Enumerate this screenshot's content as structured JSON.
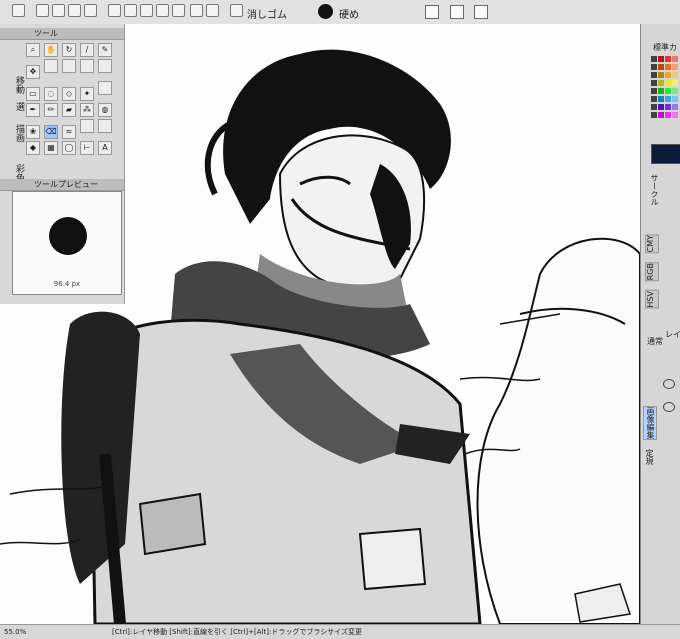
{
  "toolbar": {
    "eraser_label": "消しゴム",
    "hardness_label": "硬め",
    "icons": [
      "gear-icon",
      "new-file-icon",
      "open-file-icon",
      "save-icon",
      "print-icon",
      "undo-icon",
      "redo-icon",
      "cut-icon",
      "copy-icon",
      "paste-icon",
      "transform-icon",
      "select-icon",
      "pen-icon",
      "eraser-icon"
    ],
    "color": "#111111"
  },
  "left_panel": {
    "tool_title": "ツール",
    "preview_title": "ツールプレビュー",
    "side_labels": [
      "移動",
      "選",
      "描画",
      "彩色"
    ],
    "brush_size": "96.4 px"
  },
  "right_panel": {
    "std_color_title": "標準カ",
    "circle_title": "サークル",
    "color_modes": [
      "HSV",
      "RGB",
      "CMY"
    ],
    "layer_title": "レイ",
    "blend_mode": "通常",
    "edit_tab": "画像編集",
    "normal_tab": "定規"
  },
  "status": {
    "zoom": "55.0%",
    "hint": "[Ctrl]:レイヤ移動 [Shift]:直線を引く [Ctrl]+[Alt]:ドラッグでブラシサイズ変更"
  }
}
